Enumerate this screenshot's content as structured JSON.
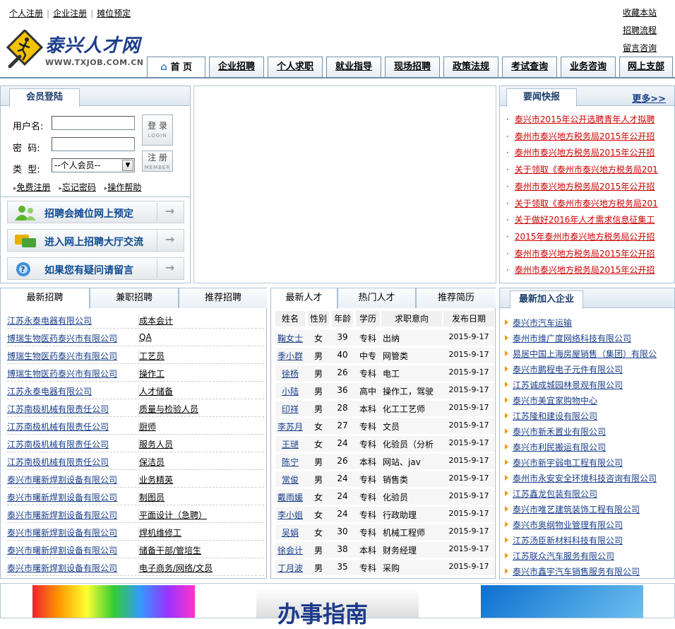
{
  "top_links": [
    "个人注册",
    "企业注册",
    "摊位预定"
  ],
  "right_links": [
    "收藏本站",
    "招聘流程",
    "留言咨询"
  ],
  "logo": {
    "name": "泰兴人才网",
    "url": "WWW.TXJOB.COM.CN"
  },
  "nav": [
    "首 页",
    "企业招聘",
    "个人求职",
    "就业指导",
    "现场招聘",
    "政策法规",
    "考试查询",
    "业务咨询",
    "网上支部"
  ],
  "login": {
    "tab": "会员登陆",
    "username_label": "用户名:",
    "password_label": "密  码:",
    "type_label": "类  型:",
    "type_value": "--个人会员--",
    "login_btn": "登 录",
    "login_sub": "LOGIN",
    "register_btn": "注 册",
    "register_sub": "MEMBER",
    "links": [
      "免费注册",
      "忘记密码",
      "操作帮助"
    ]
  },
  "big_buttons": [
    "招聘会摊位网上预定",
    "进入网上招聘大厅交流",
    "如果您有疑问请留言"
  ],
  "news": {
    "tab": "要闻快报",
    "more": "更多>>",
    "items": [
      "泰兴市2015年公开选聘青年人才拟聘",
      "泰州市泰兴地方税务局2015年公开招",
      "泰州市泰兴地方税务局2015年公开招",
      "关于领取《泰州市泰兴地方税务局201",
      "泰州市泰兴地方税务局2015年公开招",
      "关于领取《泰州市泰兴地方税务局201",
      "关于做好2016年人才需求信息征集工",
      "2015年泰州市泰兴地方税务局公开招",
      "泰州市泰兴地方税务局2015年公开招",
      "泰州市泰兴地方税务局2015年公开招"
    ]
  },
  "jobs": {
    "tabs": [
      "最新招聘",
      "兼职招聘",
      "推荐招聘"
    ],
    "rows": [
      [
        "江苏永泰电器有限公司",
        "成本会计"
      ],
      [
        "博瑞生物医药泰兴市有限公司",
        "QA"
      ],
      [
        "博瑞生物医药泰兴市有限公司",
        "工艺员"
      ],
      [
        "博瑞生物医药泰兴市有限公司",
        "操作工"
      ],
      [
        "江苏永泰电器有限公司",
        "人才储备"
      ],
      [
        "江苏南极机械有限责任公司",
        "质量与检验人员"
      ],
      [
        "江苏南极机械有限责任公司",
        "厨师"
      ],
      [
        "江苏南极机械有限责任公司",
        "服务人员"
      ],
      [
        "江苏南极机械有限责任公司",
        "保洁员"
      ],
      [
        "泰兴市曙新焊割设备有限公司",
        "业务精英"
      ],
      [
        "泰兴市曙新焊割设备有限公司",
        "制图员"
      ],
      [
        "泰兴市曙新焊割设备有限公司",
        "平面设计（急聘）"
      ],
      [
        "泰兴市曙新焊割设备有限公司",
        "焊机维修工"
      ],
      [
        "泰兴市曙新焊割设备有限公司",
        "储备干部/管培生"
      ],
      [
        "泰兴市曙新焊割设备有限公司",
        "电子商务/网络/文员"
      ]
    ]
  },
  "talents": {
    "tabs": [
      "最新人才",
      "热门人才",
      "推荐简历"
    ],
    "headers": [
      "姓名",
      "性别",
      "年龄",
      "学历",
      "求职意向",
      "发布日期"
    ],
    "rows": [
      [
        "鞠女士",
        "女",
        "39",
        "专科",
        "出纳",
        "2015-9-17"
      ],
      [
        "季小群",
        "男",
        "40",
        "中专",
        "网管类",
        "2015-9-17"
      ],
      [
        "徐杨",
        "男",
        "26",
        "专科",
        "电工",
        "2015-9-17"
      ],
      [
        "小陆",
        "男",
        "36",
        "高中",
        "操作工，驾驶",
        "2015-9-17"
      ],
      [
        "印祥",
        "男",
        "28",
        "本科",
        "化工工艺师",
        "2015-9-17"
      ],
      [
        "李苏月",
        "女",
        "27",
        "专科",
        "文员",
        "2015-9-17"
      ],
      [
        "王琎",
        "女",
        "24",
        "专科",
        "化验员（分析",
        "2015-9-17"
      ],
      [
        "陈宁",
        "男",
        "26",
        "本科",
        "网站、jav",
        "2015-9-17"
      ],
      [
        "常俊",
        "男",
        "24",
        "专科",
        "销售类",
        "2015-9-17"
      ],
      [
        "戴雨媛",
        "女",
        "24",
        "专科",
        "化验员",
        "2015-9-17"
      ],
      [
        "李小姐",
        "女",
        "24",
        "专科",
        "行政助理",
        "2015-9-17"
      ],
      [
        "吴娟",
        "女",
        "30",
        "专科",
        "机械工程师",
        "2015-9-17"
      ],
      [
        "徐会计",
        "男",
        "38",
        "本科",
        "财务经理",
        "2015-9-17"
      ],
      [
        "丁月波",
        "男",
        "35",
        "专科",
        "采购",
        "2015-9-17"
      ]
    ]
  },
  "companies": {
    "tab": "最新加入企业",
    "items": [
      "泰兴市汽车运输",
      "泰州市维广度网络科技有限公司",
      "易居中国上海房屋销售（集团）有限公",
      "泰兴市鹏程电子元件有限公司",
      "江苏诚成城园林景观有限公司",
      "泰兴市美宜家购物中心",
      "江苏隆和建设有限公司",
      "泰兴市新禾置业有限公司",
      "泰兴市利民搬运有限公司",
      "泰兴市新宇弱电工程有限公司",
      "泰州市永安安全环境科技咨询有限公司",
      "江苏鑫龙包装有限公司",
      "泰兴市唯艺建筑装饰工程有限公司",
      "泰兴市奥纲物业管理有限公司",
      "江苏汤臣新材料科技有限公司",
      "江苏联众汽车服务有限公司",
      "泰兴市鑫宇汽车销售服务有限公司"
    ]
  },
  "banner2_text": "办事指南",
  "colors": {
    "accent": "#1a3f8a",
    "news": "#cc0000",
    "border": "#a9bfd3"
  }
}
